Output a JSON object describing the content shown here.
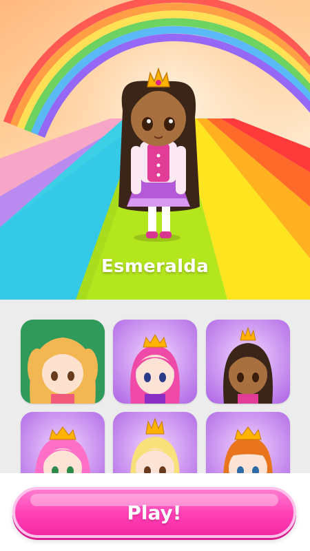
{
  "selected_character": {
    "name": "Esmeralda"
  },
  "characters": [
    {
      "id": "c1",
      "background": "green"
    },
    {
      "id": "c2",
      "background": "purple"
    },
    {
      "id": "c3",
      "background": "purple",
      "selected": true
    },
    {
      "id": "c4",
      "background": "purple"
    },
    {
      "id": "c5",
      "background": "purple"
    },
    {
      "id": "c6",
      "background": "purple"
    }
  ],
  "play_button": {
    "label": "Play!"
  },
  "colors": {
    "accent_pink": "#ff3fb4",
    "card_green": "#2f9a5a",
    "card_purple": "#b86ae6"
  }
}
